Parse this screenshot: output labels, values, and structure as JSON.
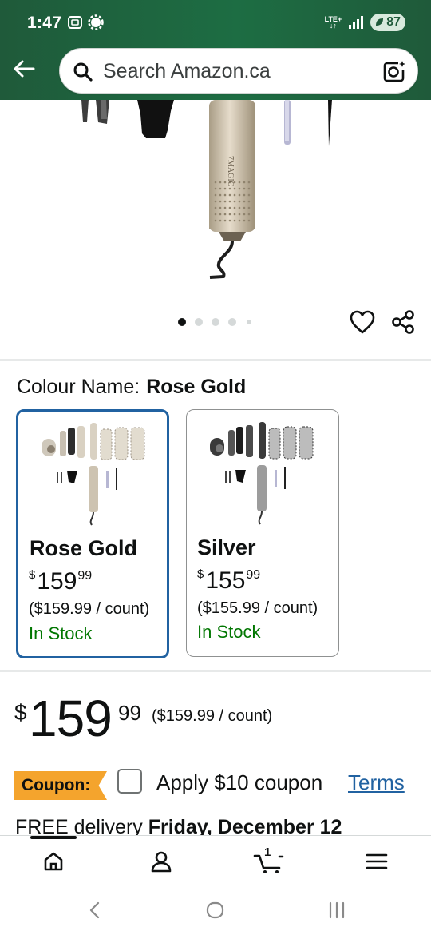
{
  "status_bar": {
    "time": "1:47",
    "network": "LTE+",
    "battery": "87"
  },
  "header": {
    "search_placeholder": "Search Amazon.ca",
    "icons": [
      "back-arrow-icon",
      "search-icon",
      "camera-lens-icon"
    ]
  },
  "product_image": {
    "brand_text": "7MAGIC",
    "carousel": {
      "count": 5,
      "active_index": 0
    },
    "icons": [
      "heart-icon",
      "share-icon"
    ]
  },
  "colour": {
    "label": "Colour Name:",
    "selected": "Rose Gold",
    "options": [
      {
        "name": "Rose Gold",
        "price_currency": "$",
        "price_whole": "159",
        "price_cents": "99",
        "unit_price": "($159.99 / count)",
        "stock": "In Stock",
        "selected": true
      },
      {
        "name": "Silver",
        "price_currency": "$",
        "price_whole": "155",
        "price_cents": "99",
        "unit_price": "($155.99 / count)",
        "stock": "In Stock",
        "selected": false
      }
    ]
  },
  "price": {
    "currency": "$",
    "whole": "159",
    "cents": "99",
    "unit_price": "($159.99 / count)"
  },
  "coupon": {
    "badge": "Coupon:",
    "text": "Apply $10 coupon",
    "terms": "Terms",
    "checked": false
  },
  "delivery": {
    "prefix": "FREE delivery",
    "date": "Friday, December 12"
  },
  "bottom_nav": {
    "items": [
      "home-icon",
      "account-icon",
      "cart-icon",
      "menu-icon"
    ],
    "cart_count": "1",
    "active": "home"
  },
  "colors": {
    "header_bg": "#1f5a3a",
    "link": "#2162a1",
    "in_stock": "#007600",
    "coupon": "#f4a42d",
    "selected_border": "#2162a1"
  }
}
